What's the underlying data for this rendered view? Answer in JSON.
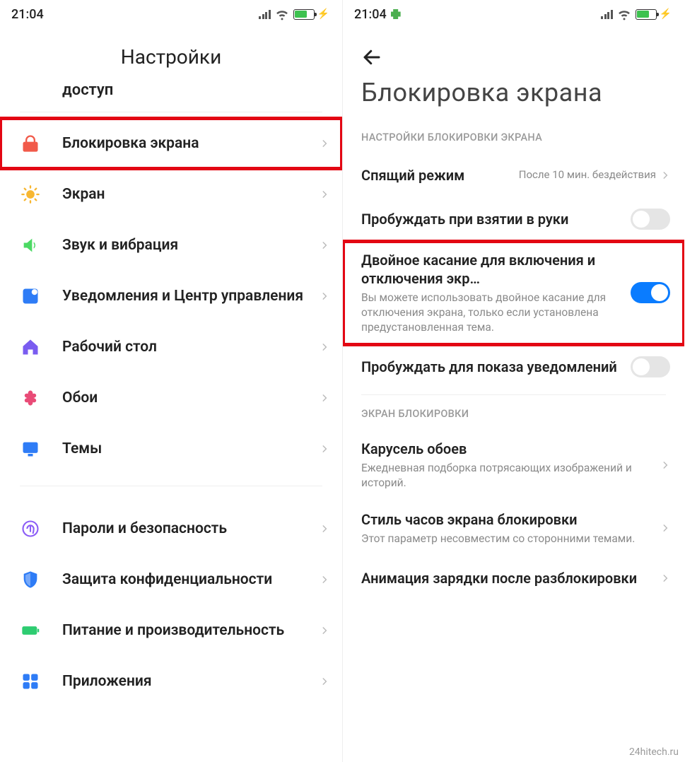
{
  "status": {
    "time": "21:04",
    "signal_icon": "signal-icon",
    "wifi_icon": "wifi-icon",
    "battery_icon": "battery-icon",
    "bolt_icon": "bolt-icon",
    "puzzle_icon": "puzzle-icon"
  },
  "left": {
    "title": "Настройки",
    "partial_prev": "доступ",
    "items": [
      {
        "label": "Блокировка экрана",
        "icon": "lock-icon",
        "color": "#f15a4a",
        "highlighted": true
      },
      {
        "label": "Экран",
        "icon": "sun-icon",
        "color": "#f7b731"
      },
      {
        "label": "Звук и вибрация",
        "icon": "speaker-icon",
        "color": "#4cd964"
      },
      {
        "label": "Уведомления и Центр управления",
        "icon": "notifications-icon",
        "color": "#2e7cf6"
      },
      {
        "label": "Рабочий стол",
        "icon": "home-icon",
        "color": "#7a5cf0"
      },
      {
        "label": "Обои",
        "icon": "flower-icon",
        "color": "#e94b77"
      },
      {
        "label": "Темы",
        "icon": "themes-icon",
        "color": "#2e7cf6"
      }
    ],
    "items2": [
      {
        "label": "Пароли и безопасность",
        "icon": "fingerprint-icon",
        "color": "#8b5cf6"
      },
      {
        "label": "Защита конфиденциальности",
        "icon": "shield-icon",
        "color": "#2e7cf6"
      },
      {
        "label": "Питание и производительность",
        "icon": "battery-setting-icon",
        "color": "#2ecc71"
      },
      {
        "label": "Приложения",
        "icon": "apps-icon",
        "color": "#2e7cf6"
      }
    ]
  },
  "right": {
    "title": "Блокировка экрана",
    "section1": "НАСТРОЙКИ БЛОКИРОВКИ ЭКРАНА",
    "opts": [
      {
        "title": "Спящий режим",
        "value": "После 10 мин. бездействия",
        "type": "nav"
      },
      {
        "title": "Пробуждать при взятии в руки",
        "type": "toggle",
        "on": false
      },
      {
        "title": "Двойное касание для включения и отключения экр…",
        "sub": "Вы можете использовать двойное касание для отключения экрана, только если установлена предустановленная тема.",
        "type": "toggle",
        "on": true,
        "highlighted": true
      },
      {
        "title": "Пробуждать для показа уведомлений",
        "type": "toggle",
        "on": false
      }
    ],
    "section2": "ЭКРАН БЛОКИРОВКИ",
    "opts2": [
      {
        "title": "Карусель обоев",
        "sub": "Ежедневная подборка потрясающих изображений и историй.",
        "type": "nav"
      },
      {
        "title": "Стиль часов экрана блокировки",
        "sub": "Этот параметр несовместим со сторонними темами.",
        "type": "nav"
      },
      {
        "title": "Анимация зарядки после разблокировки",
        "sub": "",
        "type": "nav"
      }
    ]
  },
  "watermark": "24hitech.ru",
  "colors": {
    "highlight": "#e30613",
    "toggle_on": "#0a7cff"
  }
}
